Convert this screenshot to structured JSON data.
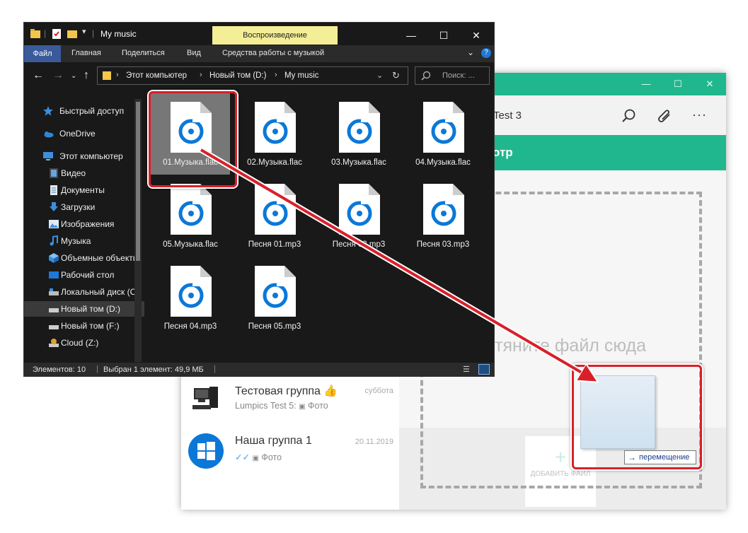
{
  "chat": {
    "header_title": "Test 3",
    "greenbar_text": "отр",
    "drop_text": "етяните файл сюда",
    "add_file_label": "ДОБАВИТЬ ФАЙЛ",
    "items": [
      {
        "name": "Тестовая группа",
        "emoji": "👍",
        "date": "суббота",
        "sub_author": "Lumpics Test 5:",
        "sub_text": "Фото"
      },
      {
        "name": "Наша группа 1",
        "date": "20.11.2019",
        "sub_text": "Фото"
      }
    ]
  },
  "drag": {
    "tooltip": "перемещение"
  },
  "explorer": {
    "title": "My music",
    "contextual_tab_group": "Воспроизведение",
    "ribbon_tabs": [
      "Файл",
      "Главная",
      "Поделиться",
      "Вид",
      "Средства работы с музыкой"
    ],
    "breadcrumb": [
      "Этот компьютер",
      "Новый том (D:)",
      "My music"
    ],
    "search_placeholder": "Поиск: ...",
    "nav_items": [
      {
        "label": "Быстрый доступ",
        "icon": "star-icon"
      },
      {
        "label": "OneDrive",
        "icon": "cloud-icon"
      },
      {
        "label": "Этот компьютер",
        "icon": "computer-icon"
      },
      {
        "label": "Видео",
        "icon": "video-icon"
      },
      {
        "label": "Документы",
        "icon": "documents-icon"
      },
      {
        "label": "Загрузки",
        "icon": "download-icon"
      },
      {
        "label": "Изображения",
        "icon": "pictures-icon"
      },
      {
        "label": "Музыка",
        "icon": "music-icon"
      },
      {
        "label": "Объемные объекты",
        "icon": "3d-objects-icon"
      },
      {
        "label": "Рабочий стол",
        "icon": "desktop-icon"
      },
      {
        "label": "Локальный диск (C:)",
        "icon": "drive-icon"
      },
      {
        "label": "Новый том (D:)",
        "icon": "drive-icon"
      },
      {
        "label": "Новый том (F:)",
        "icon": "drive-icon"
      },
      {
        "label": "Cloud (Z:)",
        "icon": "network-drive-icon"
      }
    ],
    "files": [
      "01.Музыка.flac",
      "02.Музыка.flac",
      "03.Музыка.flac",
      "04.Музыка.flac",
      "05.Музыка.flac",
      "Песня 01.mp3",
      "Песня 02.mp3",
      "Песня 03.mp3",
      "Песня 04.mp3",
      "Песня 05.mp3"
    ],
    "status_count": "Элементов: 10",
    "status_selected": "Выбран 1 элемент: 49,9 МБ"
  },
  "colors": {
    "accent_green": "#21b78e",
    "highlight_red": "#d9202a",
    "music_icon_blue": "#0b78d7",
    "explorer_bg": "#191919"
  }
}
